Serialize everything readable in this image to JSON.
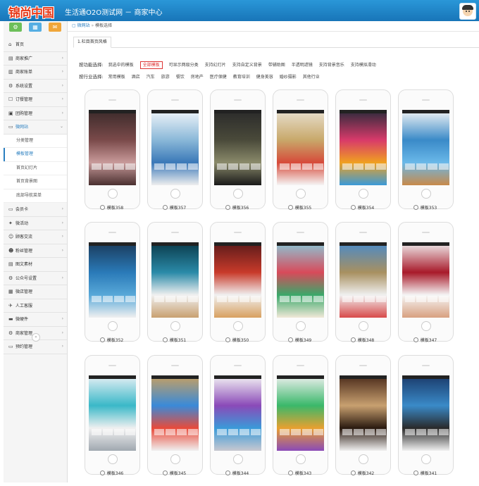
{
  "header": {
    "logo_text": "锦尚中国",
    "title": "生活通O2O测试网 － 商家中心"
  },
  "sidebar": {
    "quick_buttons": [
      {
        "icon": "gear-icon",
        "glyph": "⚙",
        "color": "#6cbf5a"
      },
      {
        "icon": "shop-icon",
        "glyph": "▦",
        "color": "#55aee3"
      },
      {
        "icon": "mail-icon",
        "glyph": "✉",
        "color": "#f0a63a"
      }
    ],
    "items": [
      {
        "label": "首页",
        "glyph": "⌂"
      },
      {
        "label": "商家推广",
        "glyph": "▤",
        "arrow": "›"
      },
      {
        "label": "商家账单",
        "glyph": "▥",
        "arrow": "›"
      },
      {
        "label": "系统设置",
        "glyph": "⚙",
        "arrow": "›"
      },
      {
        "label": "订餐管理",
        "glyph": "☐",
        "arrow": "›"
      },
      {
        "label": "团购管理",
        "glyph": "▣",
        "arrow": "›"
      },
      {
        "label": "微网站",
        "glyph": "▭",
        "arrow": "⌄",
        "active": true
      }
    ],
    "sub_items": [
      {
        "label": "分类管理"
      },
      {
        "label": "模板管理",
        "current": true
      },
      {
        "label": "首页幻灯片"
      },
      {
        "label": "首页背景图"
      },
      {
        "label": "底部导航菜单"
      }
    ],
    "items_after": [
      {
        "label": "会员卡",
        "glyph": "▭",
        "arrow": "›"
      },
      {
        "label": "微活动",
        "glyph": "✦",
        "arrow": "›"
      },
      {
        "label": "顾客交流",
        "glyph": "☺",
        "arrow": "›"
      },
      {
        "label": "粉丝管理",
        "glyph": "☻",
        "arrow": "›"
      },
      {
        "label": "图文素材",
        "glyph": "▤"
      },
      {
        "label": "公众号设置",
        "glyph": "⚙",
        "arrow": "›"
      },
      {
        "label": "微店管理",
        "glyph": "▦"
      },
      {
        "label": "人工客服",
        "glyph": "✈"
      },
      {
        "label": "微硬件",
        "glyph": "▬",
        "arrow": "›"
      },
      {
        "label": "商家管理",
        "glyph": "⚙",
        "arrow": "›"
      },
      {
        "label": "预约管理",
        "glyph": "▭",
        "arrow": "›"
      }
    ],
    "collapse_glyph": "«"
  },
  "breadcrumb": {
    "home": "微网站",
    "separator": "»",
    "current": "模板选择"
  },
  "tab": {
    "label": "1.栏目首页风格"
  },
  "filters": {
    "function": {
      "label": "按功能选择:",
      "options": [
        "我选中的模板",
        "全部模板",
        "可显示两级分类",
        "支持幻灯片",
        "支持自定义背景",
        "带辅助图",
        "半透明滤镜",
        "支持背景音乐",
        "支持模拟滑动"
      ],
      "selected": "全部模板"
    },
    "industry": {
      "label": "按行业选择:",
      "options": [
        "常用模板",
        "酒店",
        "汽车",
        "旅游",
        "餐饮",
        "房地产",
        "医疗保健",
        "教育培训",
        "健身美容",
        "婚纱摄影",
        "其他行业"
      ]
    }
  },
  "templates": [
    {
      "label": "模板358",
      "colors": [
        "#3a2a2a",
        "#7a4a4a",
        "#c89a9a",
        "#4a3030"
      ]
    },
    {
      "label": "模板357",
      "colors": [
        "#f2f6fa",
        "#8ab8d8",
        "#3a78b8",
        "#eeeeee"
      ]
    },
    {
      "label": "模板356",
      "colors": [
        "#2a2a2a",
        "#4a4a3a",
        "#8a8a6a",
        "#1a1a1a"
      ]
    },
    {
      "label": "模板355",
      "colors": [
        "#e8e0d0",
        "#c8a86a",
        "#d64a3a",
        "#f5f5f5"
      ]
    },
    {
      "label": "模板354",
      "colors": [
        "#2a2a3a",
        "#d83a6a",
        "#f0a020",
        "#3a9ad8"
      ]
    },
    {
      "label": "模板353",
      "colors": [
        "#f5f5f5",
        "#3a8ac8",
        "#6ab8e8",
        "#c88a4a"
      ]
    },
    {
      "label": "模板352",
      "colors": [
        "#1a3a5a",
        "#2a7ab8",
        "#58a8d8",
        "#f0f0f0"
      ]
    },
    {
      "label": "模板351",
      "colors": [
        "#0a3a4a",
        "#2a8aa8",
        "#f0f0f0",
        "#c8a070"
      ]
    },
    {
      "label": "模板350",
      "colors": [
        "#5a1a1a",
        "#c83a2a",
        "#f0f0f0",
        "#d8a060"
      ]
    },
    {
      "label": "模板349",
      "colors": [
        "#8ac8d8",
        "#d84a5a",
        "#3aa86a",
        "#f0e8d8"
      ]
    },
    {
      "label": "模板348",
      "colors": [
        "#4a8ac8",
        "#a89060",
        "#f0f0f0",
        "#d84a4a"
      ]
    },
    {
      "label": "模板347",
      "colors": [
        "#f0f0f0",
        "#a81a2a",
        "#f5f5f5",
        "#d8a080"
      ]
    },
    {
      "label": "模板346",
      "colors": [
        "#e8f0f5",
        "#3ab8c8",
        "#f0f0f0",
        "#a0a8b0"
      ]
    },
    {
      "label": "模板345",
      "colors": [
        "#c8a060",
        "#3a8ad8",
        "#e84a3a",
        "#f0f0f0"
      ]
    },
    {
      "label": "模板344",
      "colors": [
        "#f5f5f5",
        "#8a4ab8",
        "#3a9ad8",
        "#c8c8d0"
      ]
    },
    {
      "label": "模板343",
      "colors": [
        "#f0f0f0",
        "#3ab86a",
        "#e8a030",
        "#8a4ab8"
      ]
    },
    {
      "label": "模板342",
      "colors": [
        "#4a2a1a",
        "#c8a070",
        "#2a1a10",
        "#f0f0f0"
      ]
    },
    {
      "label": "模板341",
      "colors": [
        "#1a3a6a",
        "#3a8ac8",
        "#2a2a2a",
        "#f0f0f0"
      ]
    }
  ]
}
